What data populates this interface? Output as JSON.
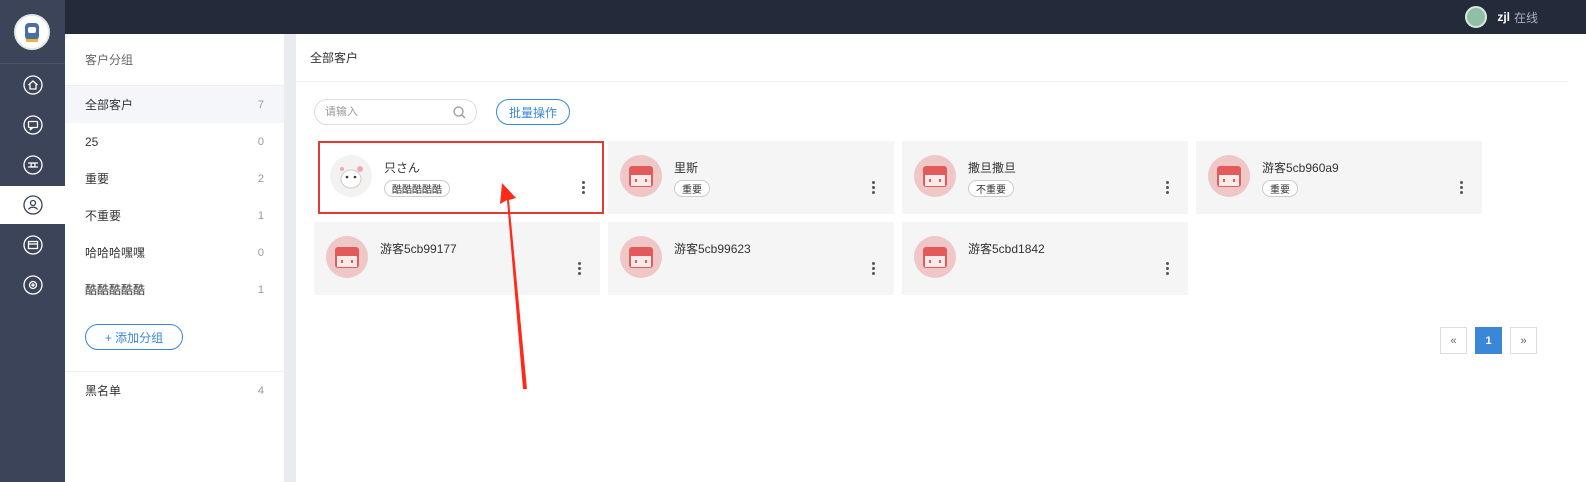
{
  "topbar": {
    "user_name": "zjl",
    "user_status": "在线"
  },
  "rail": {
    "items": [
      {
        "icon": "home-icon"
      },
      {
        "icon": "chat-icon"
      },
      {
        "icon": "history-icon"
      },
      {
        "icon": "customer-icon",
        "active": true
      },
      {
        "icon": "shop-icon"
      },
      {
        "icon": "settings-icon"
      }
    ]
  },
  "groups": {
    "title": "客户分组",
    "items": [
      {
        "label": "全部客户",
        "count": "7"
      },
      {
        "label": "25",
        "count": "0"
      },
      {
        "label": "重要",
        "count": "2"
      },
      {
        "label": "不重要",
        "count": "1"
      },
      {
        "label": "哈哈哈嘿嘿",
        "count": "0"
      },
      {
        "label": "酷酷酷酷酷",
        "count": "1"
      }
    ],
    "add_label": "+ 添加分组",
    "blacklist": {
      "label": "黑名单",
      "count": "4"
    }
  },
  "main": {
    "title": "全部客户",
    "search_placeholder": "请输入",
    "batch_label": "批量操作",
    "customers": [
      {
        "name": "只さん",
        "tag": "酷酷酷酷酷",
        "selected": true
      },
      {
        "name": "里斯",
        "tag": "重要"
      },
      {
        "name": "撒旦撒旦",
        "tag": "不重要"
      },
      {
        "name": "游客5cb960a9",
        "tag": "重要"
      },
      {
        "name": "游客5cb99177",
        "tag": ""
      },
      {
        "name": "游客5cb99623",
        "tag": ""
      },
      {
        "name": "游客5cbd1842",
        "tag": ""
      }
    ],
    "pager": {
      "prev": "«",
      "current": "1",
      "next": "»"
    }
  },
  "colors": {
    "topbar": "#232a3a",
    "rail": "#3b4459",
    "accent": "#3a87d8",
    "highlight": "#e53935"
  }
}
